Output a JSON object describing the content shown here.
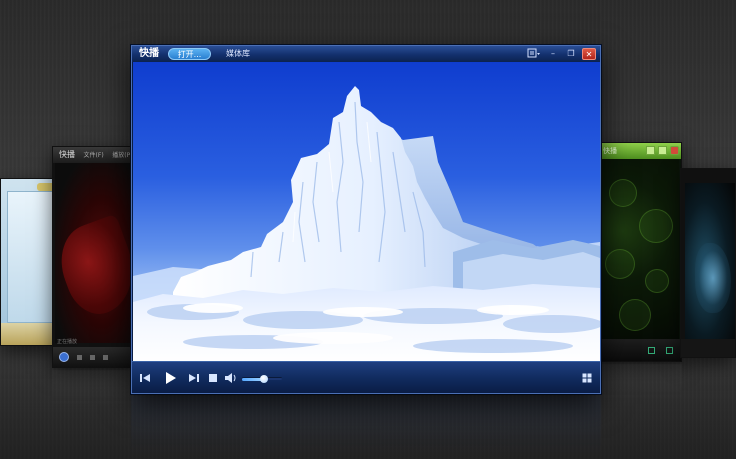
{
  "app": {
    "title": "快播",
    "tabs": [
      {
        "label": "打开..."
      },
      {
        "label": "媒体库"
      }
    ]
  },
  "window_controls": {
    "menu_icon": "menu-icon",
    "minimize_glyph": "–",
    "restore_glyph": "❐",
    "close_glyph": "✕"
  },
  "controls": {
    "prev_glyph": "⏮",
    "play_glyph": "▶",
    "next_glyph": "⏭",
    "stop_glyph": "■",
    "volume_glyph": "🔈",
    "volume_level": 0.55,
    "fullscreen_glyph": "⛶"
  },
  "background_skins": {
    "left_title": "快播",
    "left_menu": [
      "文件(F)",
      "播放(P)"
    ],
    "left_status": "正在播放",
    "right_title": "快播"
  },
  "colors": {
    "accent": "#2a7fd0",
    "titlebar": "#13306d",
    "close": "#b2241b"
  }
}
